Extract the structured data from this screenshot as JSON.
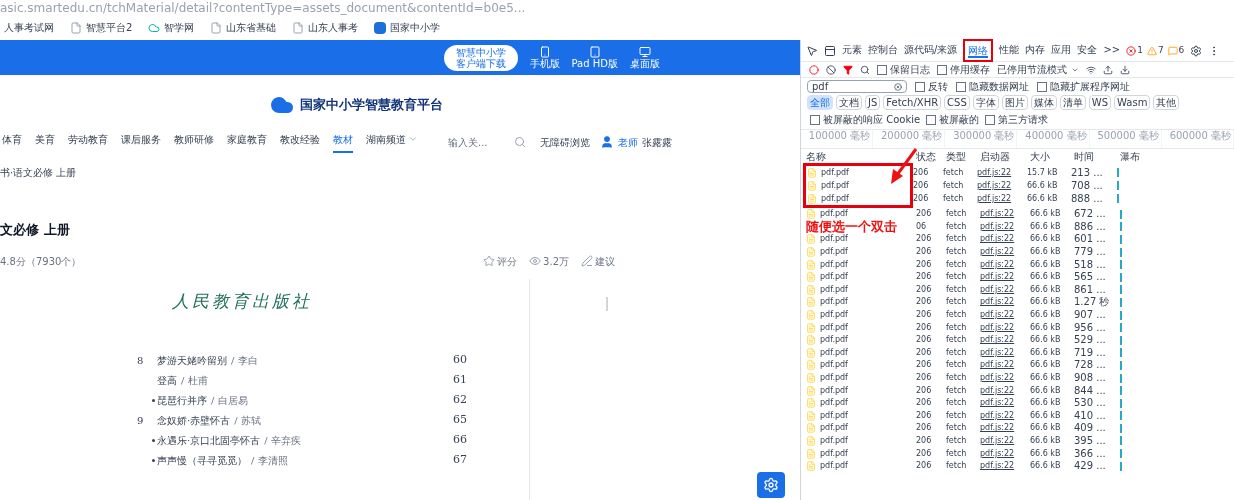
{
  "address_bar": {
    "url": "asic.smartedu.cn/tchMaterial/detail?contentType=assets_document&contentId=b0e5..."
  },
  "bookmarks": [
    {
      "label": "人事考试网"
    },
    {
      "label": "智慧平台2",
      "kind": "page"
    },
    {
      "label": "智学网",
      "kind": "cloud"
    },
    {
      "label": "山东省基础",
      "kind": "page"
    },
    {
      "label": "山东人事考",
      "kind": "page"
    },
    {
      "label": "国家中小学",
      "kind": "app"
    }
  ],
  "header": {
    "download_button": [
      "智慧中小学",
      "客户端下载"
    ],
    "devices": [
      {
        "label": "手机版",
        "kind": "phone"
      },
      {
        "label": "Pad HD版",
        "kind": "tablet"
      },
      {
        "label": "桌面版",
        "kind": "desktop"
      }
    ]
  },
  "site": {
    "title": "国家中小学智慧教育平台"
  },
  "nav": [
    {
      "label": "体育",
      "selected": false
    },
    {
      "label": "美育",
      "selected": false
    },
    {
      "label": "劳动教育",
      "selected": false
    },
    {
      "label": "课后服务",
      "selected": false
    },
    {
      "label": "教师研修",
      "selected": false
    },
    {
      "label": "家庭教育",
      "selected": false
    },
    {
      "label": "教改经验",
      "selected": false
    },
    {
      "label": "教材",
      "selected": true
    },
    {
      "label": "湖南频道",
      "selected": false,
      "dropdown": true
    }
  ],
  "search": {
    "placeholder": "输入关..."
  },
  "accessibility": "无障碍浏览",
  "user": {
    "role": "老师",
    "name": "张露露"
  },
  "breadcrumb": "书·语文必修 上册",
  "book": {
    "title": "文必修 上册",
    "rating": "4.8分（7930个）",
    "actions": [
      {
        "label": "评分",
        "kind": "star"
      },
      {
        "label": "3.2万",
        "kind": "eye"
      },
      {
        "label": "建议",
        "kind": "edit"
      }
    ],
    "publisher": "人民教育出版社",
    "toc": [
      {
        "number": "8",
        "starred": false,
        "title": "梦游天姥吟留别",
        "author": "/ 李白",
        "page": "60"
      },
      {
        "starred": false,
        "title": "登高",
        "author": "/ 杜甫",
        "page": "61"
      },
      {
        "starred": true,
        "title": "琵琶行并序",
        "author": "/ 白居易",
        "page": "62"
      },
      {
        "number": "9",
        "starred": false,
        "title": "念奴娇·赤壁怀古",
        "author": "/ 苏轼",
        "page": "65"
      },
      {
        "starred": true,
        "title": "永遇乐·京口北固亭怀古",
        "author": "/ 辛弃疾",
        "page": "66"
      },
      {
        "starred": true,
        "title": "声声慢（寻寻觅觅）",
        "author": "/ 李清照",
        "page": "67"
      }
    ]
  },
  "devtools": {
    "tabs": [
      {
        "label": "元素",
        "selected": false
      },
      {
        "label": "控制台",
        "selected": false
      },
      {
        "label": "源代码/来源",
        "selected": false
      },
      {
        "label": "网络",
        "selected": true
      },
      {
        "label": "性能",
        "selected": false
      },
      {
        "label": "内存",
        "selected": false
      },
      {
        "label": "应用",
        "selected": false
      },
      {
        "label": "安全",
        "selected": false
      },
      {
        "label": ">>",
        "selected": false
      }
    ],
    "counts": [
      {
        "label": "1",
        "kind": "error"
      },
      {
        "label": "7",
        "kind": "warning"
      },
      {
        "label": "6",
        "kind": "info"
      }
    ],
    "toolbar_checks": [
      {
        "label": "保留日志",
        "checked": false
      },
      {
        "label": "停用缓存",
        "checked": false
      }
    ],
    "throttle": "已停用节流模式",
    "filter": {
      "value": "pdf"
    },
    "filter_checks": [
      {
        "label": "反转",
        "checked": false
      },
      {
        "label": "隐藏数据网址",
        "checked": false
      },
      {
        "label": "隐藏扩展程序网址",
        "checked": false
      }
    ],
    "type_chips": [
      {
        "label": "全部",
        "selected": true
      },
      {
        "label": "文档",
        "selected": false
      },
      {
        "label": "JS",
        "selected": false
      },
      {
        "label": "Fetch/XHR",
        "selected": false
      },
      {
        "label": "CSS",
        "selected": false
      },
      {
        "label": "字体",
        "selected": false
      },
      {
        "label": "图片",
        "selected": false
      },
      {
        "label": "媒体",
        "selected": false
      },
      {
        "label": "清单",
        "selected": false
      },
      {
        "label": "WS",
        "selected": false
      },
      {
        "label": "Wasm",
        "selected": false
      },
      {
        "label": "其他",
        "selected": false
      }
    ],
    "chip_checks": [
      {
        "label": "被屏蔽的响应 Cookie",
        "checked": false
      },
      {
        "label": "被屏蔽的",
        "checked": false
      },
      {
        "label": "第三方请求",
        "checked": false
      }
    ],
    "timeline": [
      "100000 毫秒",
      "200000 毫秒",
      "300000 毫秒",
      "400000 毫秒",
      "500000 毫秒",
      "600000 毫秒"
    ],
    "columns": [
      "名称",
      "状态",
      "类型",
      "启动器",
      "大小",
      "时间",
      "瀑布"
    ],
    "rows": [
      {
        "name": "pdf.pdf",
        "status": "206",
        "type": "fetch",
        "initiator": "pdf.js:22",
        "size": "15.7 kB",
        "time": "213 ..."
      },
      {
        "name": "pdf.pdf",
        "status": "206",
        "type": "fetch",
        "initiator": "pdf.js:22",
        "size": "66.6 kB",
        "time": "708 ..."
      },
      {
        "name": "pdf.pdf",
        "status": "206",
        "type": "fetch",
        "initiator": "pdf.js:22",
        "size": "66.6 kB",
        "time": "888 ..."
      },
      {
        "name": "pdf.pdf",
        "status": "206",
        "type": "fetch",
        "initiator": "pdf.js:22",
        "size": "66.6 kB",
        "time": "672 ..."
      },
      {
        "kind": "annotated",
        "status": "06",
        "type": "fetch",
        "initiator": "pdf.js:22",
        "size": "66.6 kB",
        "time": "886 ..."
      },
      {
        "name": "pdf.pdf",
        "status": "206",
        "type": "fetch",
        "initiator": "pdf.js:22",
        "size": "66.6 kB",
        "time": "601 ..."
      },
      {
        "name": "pdf.pdf",
        "status": "206",
        "type": "fetch",
        "initiator": "pdf.js:22",
        "size": "66.6 kB",
        "time": "779 ..."
      },
      {
        "name": "pdf.pdf",
        "status": "206",
        "type": "fetch",
        "initiator": "pdf.js:22",
        "size": "66.6 kB",
        "time": "518 ..."
      },
      {
        "name": "pdf.pdf",
        "status": "206",
        "type": "fetch",
        "initiator": "pdf.js:22",
        "size": "66.6 kB",
        "time": "565 ..."
      },
      {
        "name": "pdf.pdf",
        "status": "206",
        "type": "fetch",
        "initiator": "pdf.js:22",
        "size": "66.6 kB",
        "time": "861 ..."
      },
      {
        "name": "pdf.pdf",
        "status": "206",
        "type": "fetch",
        "initiator": "pdf.js:22",
        "size": "66.6 kB",
        "time": "1.27 秒"
      },
      {
        "name": "pdf.pdf",
        "status": "206",
        "type": "fetch",
        "initiator": "pdf.js:22",
        "size": "66.6 kB",
        "time": "907 ..."
      },
      {
        "name": "pdf.pdf",
        "status": "206",
        "type": "fetch",
        "initiator": "pdf.js:22",
        "size": "66.6 kB",
        "time": "956 ..."
      },
      {
        "name": "pdf.pdf",
        "status": "206",
        "type": "fetch",
        "initiator": "pdf.js:22",
        "size": "66.6 kB",
        "time": "529 ..."
      },
      {
        "name": "pdf.pdf",
        "status": "206",
        "type": "fetch",
        "initiator": "pdf.js:22",
        "size": "66.6 kB",
        "time": "719 ..."
      },
      {
        "name": "pdf.pdf",
        "status": "206",
        "type": "fetch",
        "initiator": "pdf.js:22",
        "size": "66.6 kB",
        "time": "728 ..."
      },
      {
        "name": "pdf.pdf",
        "status": "206",
        "type": "fetch",
        "initiator": "pdf.js:22",
        "size": "66.6 kB",
        "time": "908 ..."
      },
      {
        "name": "pdf.pdf",
        "status": "206",
        "type": "fetch",
        "initiator": "pdf.js:22",
        "size": "66.6 kB",
        "time": "844 ..."
      },
      {
        "name": "pdf.pdf",
        "status": "206",
        "type": "fetch",
        "initiator": "pdf.js:22",
        "size": "66.6 kB",
        "time": "530 ..."
      },
      {
        "name": "pdf.pdf",
        "status": "206",
        "type": "fetch",
        "initiator": "pdf.js:22",
        "size": "66.6 kB",
        "time": "410 ..."
      },
      {
        "name": "pdf.pdf",
        "status": "206",
        "type": "fetch",
        "initiator": "pdf.js:22",
        "size": "66.6 kB",
        "time": "409 ..."
      },
      {
        "name": "pdf.pdf",
        "status": "206",
        "type": "fetch",
        "initiator": "pdf.js:22",
        "size": "66.6 kB",
        "time": "395 ..."
      },
      {
        "name": "pdf.pdf",
        "status": "206",
        "type": "fetch",
        "initiator": "pdf.js:22",
        "size": "66.6 kB",
        "time": "366 ..."
      },
      {
        "name": "pdf.pdf",
        "status": "206",
        "type": "fetch",
        "initiator": "pdf.js:22",
        "size": "66.6 kB",
        "time": "429 ..."
      }
    ]
  },
  "annotation": {
    "text": "随便选一个双击"
  }
}
